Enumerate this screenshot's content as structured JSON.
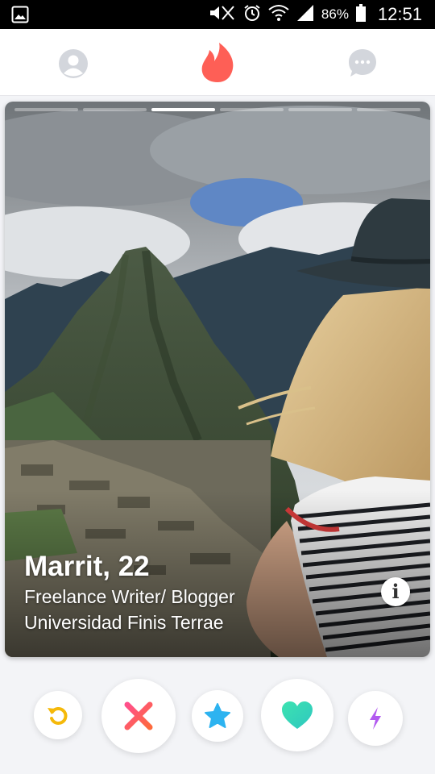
{
  "status_bar": {
    "battery": "86%",
    "time": "12:51",
    "icons": [
      "image-icon",
      "mute-icon",
      "alarm-icon",
      "wifi-icon",
      "signal-icon",
      "battery-icon"
    ]
  },
  "nav": {
    "icons": [
      "profile-icon",
      "flame-icon",
      "chat-icon"
    ],
    "active": "flame-icon",
    "colors": {
      "active": "#fe5f56",
      "inactive": "#d3d6dc"
    }
  },
  "card": {
    "photo_count": 6,
    "active_photo": 3,
    "name": "Marrit, 22",
    "job": "Freelance Writer/ Blogger",
    "school": "Universidad Finis Terrae",
    "info_label": "i"
  },
  "actions": {
    "buttons": [
      "rewind-button",
      "nope-button",
      "super-like-button",
      "like-button",
      "boost-button"
    ],
    "colors": {
      "rewind": "#f5b90a",
      "nope": "#fe4f6a",
      "superlike": "#2db3f0",
      "like": "#3cdcb4",
      "boost": "#b25af0"
    }
  }
}
